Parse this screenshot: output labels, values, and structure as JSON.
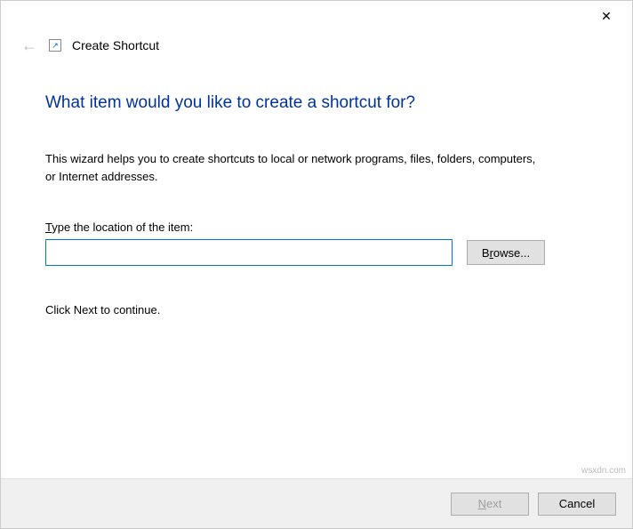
{
  "titlebar": {
    "close_glyph": "✕"
  },
  "header": {
    "back_glyph": "←",
    "title": "Create Shortcut"
  },
  "content": {
    "heading": "What item would you like to create a shortcut for?",
    "description": "This wizard helps you to create shortcuts to local or network programs, files, folders, computers, or Internet addresses.",
    "location_label_pre": "T",
    "location_label_post": "ype the location of the item:",
    "location_value": "",
    "browse_pre": "B",
    "browse_u": "r",
    "browse_post": "owse...",
    "continue_text": "Click Next to continue."
  },
  "footer": {
    "next_u": "N",
    "next_post": "ext",
    "cancel": "Cancel"
  },
  "watermark": "wsxdn.com"
}
